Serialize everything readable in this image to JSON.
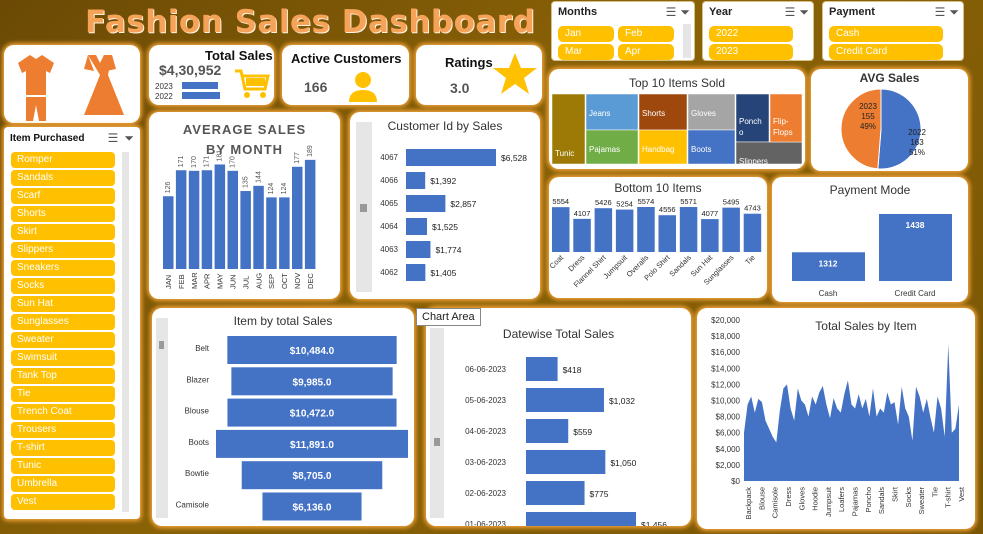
{
  "title": "Fashion Sales Dashboard",
  "slicers": {
    "months": {
      "label": "Months",
      "items": [
        "Jan",
        "Feb",
        "Mar",
        "Apr"
      ]
    },
    "year": {
      "label": "Year",
      "items": [
        "2022",
        "2023"
      ]
    },
    "payment": {
      "label": "Payment",
      "items": [
        "Cash",
        "Credit Card"
      ]
    }
  },
  "kpis": {
    "total_sales": {
      "label": "Total Sales",
      "value": "$4,30,952",
      "years": [
        "2023",
        "2022"
      ]
    },
    "active_customers": {
      "label": "Active Customers",
      "value": "166"
    },
    "ratings": {
      "label": "Ratings",
      "value": "3.0"
    }
  },
  "item_purchased": {
    "label": "Item Purchased",
    "items": [
      "Romper",
      "Sandals",
      "Scarf",
      "Shorts",
      "Skirt",
      "Slippers",
      "Sneakers",
      "Socks",
      "Sun Hat",
      "Sunglasses",
      "Sweater",
      "Swimsuit",
      "Tank Top",
      "Tie",
      "Trench Coat",
      "Trousers",
      "T-shirt",
      "Tunic",
      "Umbrella",
      "Vest"
    ]
  },
  "tooltip": "Chart Area",
  "colors": {
    "accent": "#ffc000",
    "bar": "#4472c4",
    "orange": "#ed7d31",
    "glow": "#f2a33a"
  },
  "charts": {
    "avg_month": {
      "title_line1": "AVERAGE SALES",
      "title_line2": "BY MONTH"
    },
    "customer": {
      "title": "Customer Id by Sales"
    },
    "items_sales": {
      "title": "Item by total Sales"
    },
    "datewise": {
      "title": "Datewise Total Sales"
    },
    "total_item": {
      "title": "Total Sales by Item"
    },
    "top10": {
      "title": "Top 10 Items Sold"
    },
    "bottom10": {
      "title": "Bottom 10 Items"
    },
    "avg_sales": {
      "title": "AVG Sales"
    },
    "payment_mode": {
      "title": "Payment Mode"
    }
  },
  "chart_data": [
    {
      "id": "avg_month",
      "type": "bar",
      "categories": [
        "JAN",
        "FEB",
        "MAR",
        "APR",
        "MAY",
        "JUN",
        "JUL",
        "AUG",
        "SEP",
        "OCT",
        "NOV",
        "DEC"
      ],
      "values": [
        126,
        171,
        170,
        171,
        181,
        170,
        135,
        144,
        124,
        124,
        177,
        189
      ]
    },
    {
      "id": "customer",
      "type": "bar",
      "orientation": "horizontal",
      "categories": [
        "4067",
        "4066",
        "4065",
        "4064",
        "4063",
        "4062"
      ],
      "values": [
        6528,
        1392,
        2857,
        1525,
        1774,
        1405
      ],
      "labels": [
        "$6,528",
        "$1,392",
        "$2,857",
        "$1,525",
        "$1,774",
        "$1,405"
      ]
    },
    {
      "id": "items_sales",
      "type": "bar",
      "orientation": "horizontal",
      "categories": [
        "Belt",
        "Blazer",
        "Blouse",
        "Boots",
        "Bowtie",
        "Camisole"
      ],
      "values": [
        10484,
        9985,
        10472,
        11891,
        8705,
        6136
      ],
      "labels": [
        "$10,484.0",
        "$9,985.0",
        "$10,472.0",
        "$11,891.0",
        "$8,705.0",
        "$6,136.0"
      ]
    },
    {
      "id": "datewise",
      "type": "bar",
      "orientation": "horizontal",
      "categories": [
        "06-06-2023",
        "05-06-2023",
        "04-06-2023",
        "03-06-2023",
        "02-06-2023",
        "01-06-2023"
      ],
      "values": [
        418,
        1032,
        559,
        1050,
        775,
        1456
      ],
      "labels": [
        "$418",
        "$1,032",
        "$559",
        "$1,050",
        "$775",
        "$1,456"
      ]
    },
    {
      "id": "bottom10",
      "type": "bar",
      "categories": [
        "Coat",
        "Dress",
        "Flannel Shirt",
        "Jumpsuit",
        "Overalls",
        "Polo Shirt",
        "Sandals",
        "Sun Hat",
        "Sunglasses",
        "Tie"
      ],
      "values": [
        5554,
        4107,
        5426,
        5254,
        5574,
        4556,
        5571,
        4077,
        5495,
        4743
      ]
    },
    {
      "id": "payment_mode",
      "type": "bar",
      "categories": [
        "Cash",
        "Credit Card"
      ],
      "values": [
        1312,
        1438
      ]
    },
    {
      "id": "avg_sales",
      "type": "pie",
      "slices": [
        {
          "label": "2023",
          "value": 155,
          "pct": "49%"
        },
        {
          "label": "2022",
          "value": 163,
          "pct": "51%"
        }
      ]
    },
    {
      "id": "top10",
      "type": "treemap",
      "items": [
        "Tunic",
        "Jeans",
        "Pajamas",
        "Shorts",
        "Handbag",
        "Gloves",
        "Boots",
        "Poncho",
        "Slippers",
        "Flip-Flops"
      ]
    },
    {
      "id": "total_item",
      "type": "area",
      "ylim": [
        0,
        20000
      ],
      "yticks": [
        "$0",
        "$2,000",
        "$4,000",
        "$6,000",
        "$8,000",
        "$10,000",
        "$12,000",
        "$14,000",
        "$16,000",
        "$18,000",
        "$20,000"
      ],
      "xlabels": [
        "Backpack",
        "Blouse",
        "Camisole",
        "Dress",
        "Gloves",
        "Hoodie",
        "Jumpsuit",
        "Loafers",
        "Pajamas",
        "Poncho",
        "Sandals",
        "Skirt",
        "Socks",
        "Sweater",
        "Tie",
        "T-shirt",
        "Vest"
      ],
      "values": [
        6000,
        9500,
        10500,
        8500,
        10200,
        9800,
        7500,
        6500,
        5500,
        4800,
        8700,
        11500,
        12000,
        9000,
        7500,
        11500,
        10000,
        9500,
        8000,
        10500,
        9500,
        11000,
        11800,
        9500,
        7800,
        10300,
        9000,
        8500,
        10800,
        12500,
        9500,
        9000,
        10800,
        9000,
        10200,
        8000,
        11500,
        8000,
        9000,
        8500,
        11000,
        9500,
        9800,
        7000,
        11700,
        9000,
        8000,
        5000,
        11700,
        10500,
        8500,
        10200,
        8000,
        6000,
        10500,
        9000,
        5500,
        17000,
        6000,
        6500,
        9500
      ]
    }
  ]
}
